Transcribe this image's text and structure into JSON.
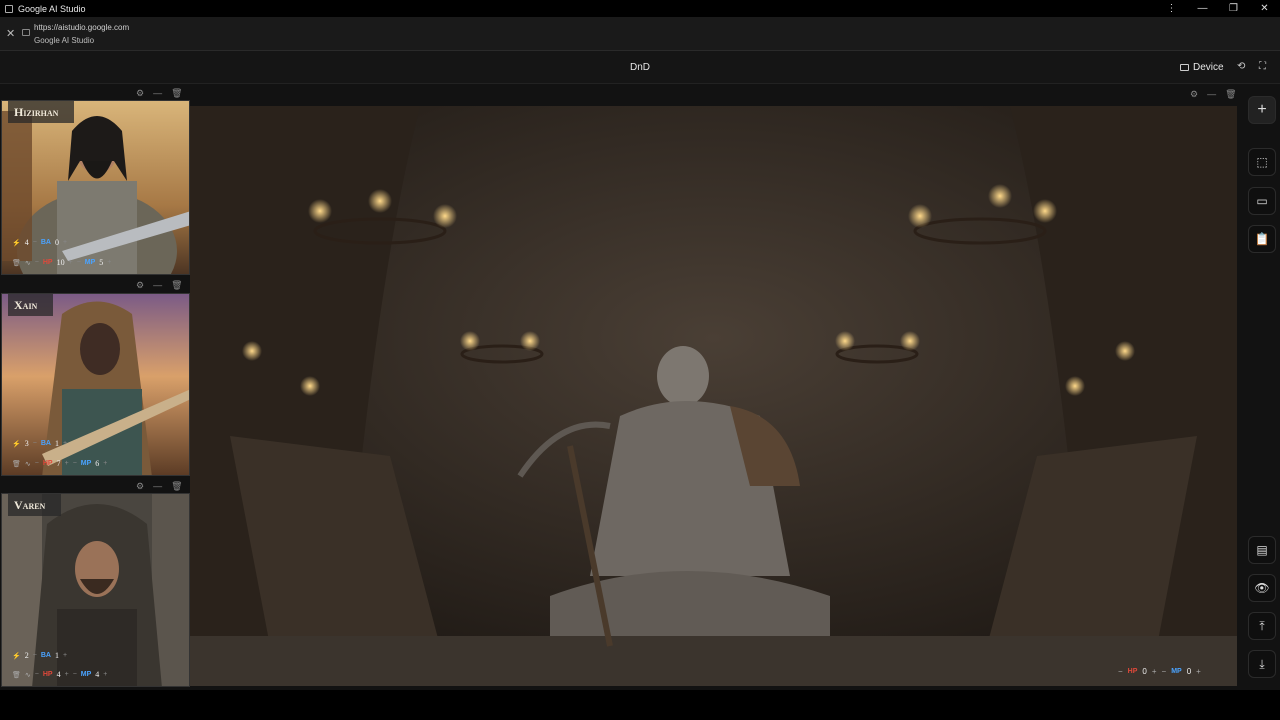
{
  "window": {
    "title": "Google AI Studio",
    "controls": [
      "⋮",
      "—",
      "❐",
      "✕"
    ]
  },
  "browser": {
    "url": "https://aistudio.google.com",
    "site_title": "Google AI Studio"
  },
  "header": {
    "title": "DnD",
    "device_label": "Device"
  },
  "characters": [
    {
      "name": "Hizirhan",
      "bolt": "4",
      "ba": "0",
      "hp": "10",
      "mp": "5"
    },
    {
      "name": "Xain",
      "bolt": "3",
      "ba": "1",
      "hp": "7",
      "mp": "6"
    },
    {
      "name": "Varen",
      "bolt": "2",
      "ba": "1",
      "hp": "4",
      "mp": "4"
    }
  ],
  "stat_labels": {
    "ba": "BA",
    "hp": "HP",
    "mp": "MP"
  },
  "scene": {
    "hp": "0",
    "mp": "0"
  },
  "colors": {
    "hp": "#e0483a",
    "mp": "#4aa3ff",
    "bolt": "#d8b34a",
    "background": "#121212"
  },
  "rail_icons": [
    "add-icon",
    "select-region-icon",
    "tablet-icon",
    "clipboard-icon",
    "panel-icon",
    "eye-icon",
    "upload-icon",
    "download-icon"
  ]
}
